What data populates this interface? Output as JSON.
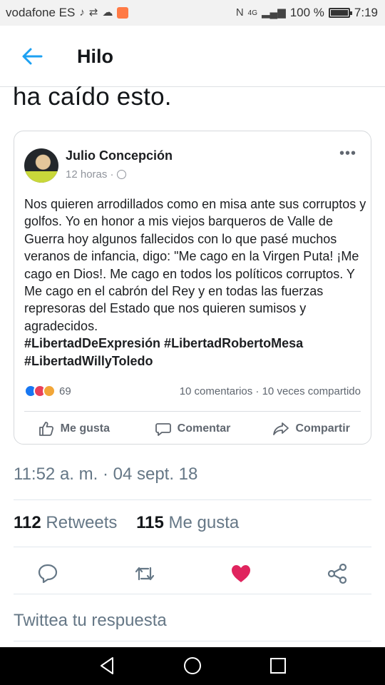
{
  "status_bar": {
    "carrier": "vodafone ES",
    "network": "4G",
    "battery": "100 %",
    "time": "7:19"
  },
  "header": {
    "title": "Hilo",
    "back_icon": "arrow-left-icon"
  },
  "tweet": {
    "text_fragment": "ha caído esto.",
    "timestamp": "11:52 a. m. · 04 sept. 18",
    "retweets_count": "112",
    "retweets_label": "Retweets",
    "likes_count": "115",
    "likes_label": "Me gusta",
    "reply_placeholder": "Twittea tu respuesta"
  },
  "embedded_post": {
    "author": "Julio Concepción",
    "time": "12 horas ·",
    "body": "Nos quieren arrodillados como en misa ante sus corruptos y golfos. Yo en honor a mis viejos barqueros de Valle de Guerra hoy algunos fallecidos con lo que pasé muchos  veranos de infancia, digo: \"Me cago en la Virgen Puta! ¡Me cago en Dios!. Me cago en todos los políticos corruptos. Y Me cago en el cabrón del Rey y en todas las fuerzas represoras del Estado que nos quieren sumisos y agradecidos.",
    "hashtags_line1": "#LibertadDeExpresión #LibertadRobertoMesa",
    "hashtags_line2": "#LibertadWillyToledo",
    "reactions_count": "69",
    "comments": "10 comentarios · 10 veces compartido",
    "actions": {
      "like": "Me gusta",
      "comment": "Comentar",
      "share": "Compartir"
    }
  },
  "colors": {
    "twitter_blue": "#1da1f2",
    "like_red": "#e0245e",
    "secondary_text": "#657786"
  }
}
